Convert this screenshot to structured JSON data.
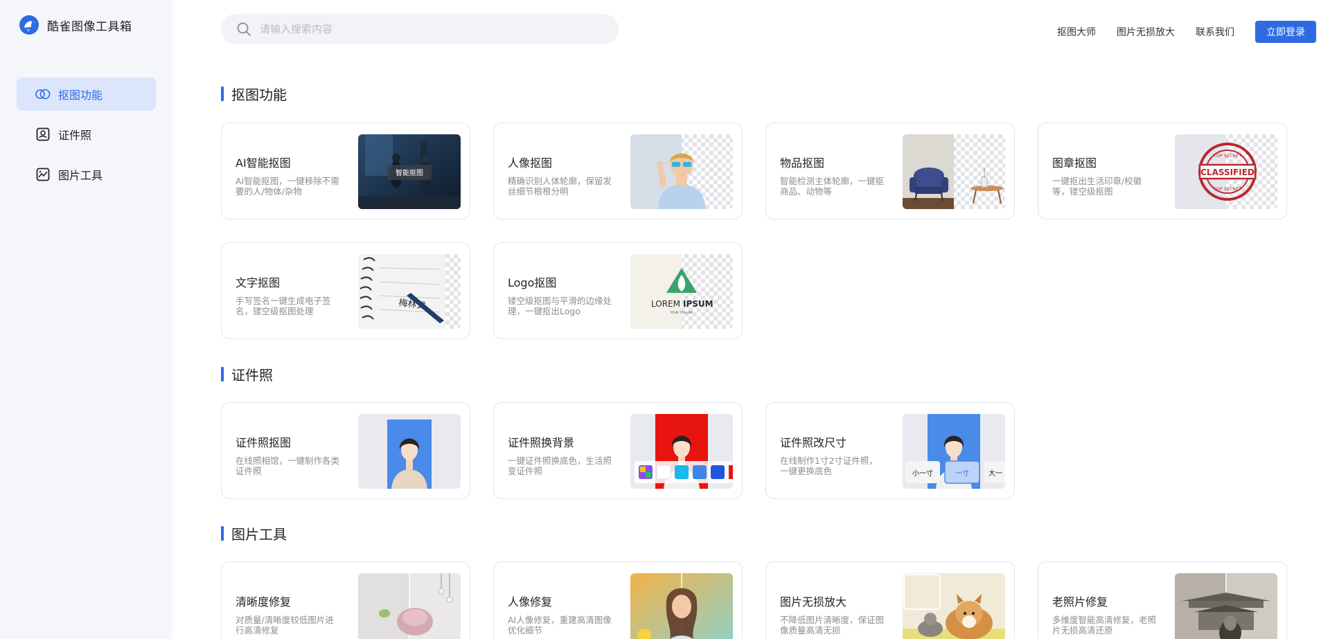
{
  "app": {
    "name": "酷雀图像工具箱"
  },
  "sidebar": {
    "items": [
      {
        "label": "抠图功能",
        "icon": "layers-icon",
        "active": true
      },
      {
        "label": "证件照",
        "icon": "id-photo-icon",
        "active": false
      },
      {
        "label": "图片工具",
        "icon": "image-tool-icon",
        "active": false
      }
    ]
  },
  "header": {
    "search_placeholder": "请输入搜索内容",
    "links": [
      "抠图大师",
      "图片无损放大",
      "联系我们"
    ],
    "login_label": "立即登录"
  },
  "colors": {
    "accent": "#2f6ae4",
    "sidebar_bg": "#f4f6fa",
    "active_bg": "#dbe5fb"
  },
  "sections": [
    {
      "title": "抠图功能",
      "cards": [
        {
          "title": "AI智能抠图",
          "desc": "AI智能抠图，一键移除不需要的人/物体/杂物",
          "thumb_label": "智能抠图"
        },
        {
          "title": "人像抠图",
          "desc": "精确识别人体轮廓，保留发丝细节根根分明"
        },
        {
          "title": "物品抠图",
          "desc": "智能检测主体轮廓，一键抠商品、动物等"
        },
        {
          "title": "图章抠图",
          "desc": "一键抠出生活印章/校徽等，镂空级抠图",
          "stamp_text": "CLASSIFIED",
          "stamp_top": "TOP SECRET",
          "stamp_bottom": "TOP SECRET"
        },
        {
          "title": "文字抠图",
          "desc": "手写签名一键生成电子签名，镂空级抠图处理",
          "signature_text": "梅林式"
        },
        {
          "title": "Logo抠图",
          "desc": "镂空级抠图与平滑的边缘处理，一键抠出Logo",
          "logo_text_a": "LOREM",
          "logo_text_b": "IPSUM",
          "logo_tagline": "YOUR TAGLINE"
        }
      ]
    },
    {
      "title": "证件照",
      "cards": [
        {
          "title": "证件照抠图",
          "desc": "在线照相馆，一键制作各类证件照"
        },
        {
          "title": "证件照换背景",
          "desc": "一键证件照换底色，生活照变证件照"
        },
        {
          "title": "证件照改尺寸",
          "desc": "在线制作1寸2寸证件照，一键更换底色",
          "size_options": [
            "小一寸",
            "一寸",
            "大一"
          ]
        }
      ]
    },
    {
      "title": "图片工具",
      "cards": [
        {
          "title": "清晰度修复",
          "desc": "对质量/清晰度较低图片进行高清修复"
        },
        {
          "title": "人像修复",
          "desc": "AI人像修复，重建高清图像优化细节"
        },
        {
          "title": "图片无损放大",
          "desc": "不降低图片清晰度，保证图像质量高清无损"
        },
        {
          "title": "老照片修复",
          "desc": "多维度智能高清修复，老照片无损高清还原"
        }
      ]
    }
  ]
}
